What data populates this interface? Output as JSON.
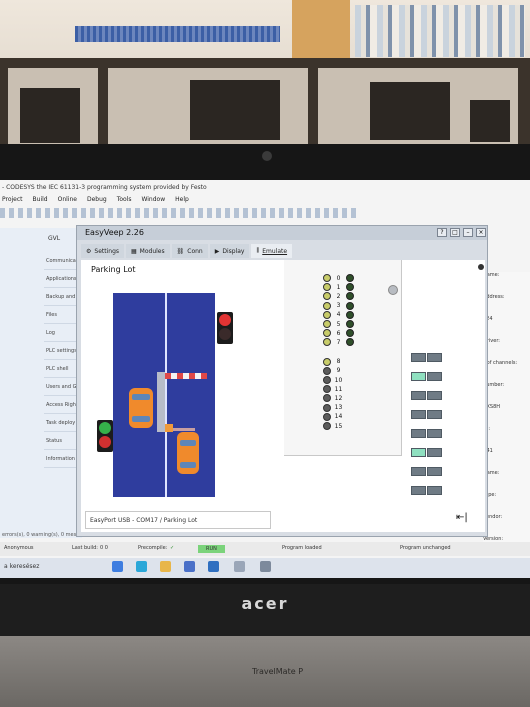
{
  "codesys": {
    "title": "- CODESYS the IEC 61131-3 programming system provided by Festo",
    "menu": [
      "Project",
      "Build",
      "Online",
      "Debug",
      "Tools",
      "Window",
      "Help"
    ],
    "gvl_tab": "GVL",
    "left_tabs": [
      "Communicat",
      "Applications",
      "Backup and",
      "Files",
      "Log",
      "PLC settings",
      "PLC shell",
      "Users and G",
      "Access Right",
      "Task deploy",
      "Status",
      "Information"
    ],
    "right_labels": [
      "Name:",
      "Address:",
      "024",
      "Driver:",
      "r of channels:",
      "number:",
      "RXS8H",
      "ID:",
      "C41",
      "Name:",
      "Type:",
      "Vendor:",
      "Version:",
      "30"
    ],
    "console_text": "errors(s), 0 warning(s), 0 message(s)",
    "status": {
      "user": "Anonymous",
      "last_build_label": "Last build:",
      "last_build_value": "0  0",
      "precompile_label": "Precompile:",
      "precompile_value": "✓",
      "run_badge": "RUN",
      "program_loaded": "Program loaded",
      "program_unchanged": "Program unchanged"
    },
    "taskbar_search": "a keresésez"
  },
  "easyveep": {
    "title": "EasyVeep 2.26",
    "window_buttons": [
      "?",
      "□",
      "–",
      "×"
    ],
    "tabs": [
      {
        "label": "Settings",
        "icon": "settings-icon"
      },
      {
        "label": "Modules",
        "icon": "modules-icon"
      },
      {
        "label": "Conn",
        "icon": "connection-icon"
      },
      {
        "label": "Display",
        "icon": "play-icon"
      },
      {
        "label": "Emulate",
        "icon": "emulate-icon"
      }
    ],
    "active_tab": "Emulate",
    "content_title": "Parking Lot",
    "io_numbers": [
      "0",
      "1",
      "2",
      "3",
      "4",
      "5",
      "6",
      "7",
      "8",
      "9",
      "10",
      "11",
      "12",
      "13",
      "14",
      "15"
    ],
    "input_states": [
      1,
      1,
      1,
      1,
      1,
      1,
      1,
      1,
      1,
      0,
      0,
      0,
      0,
      0,
      0,
      0
    ],
    "statusline": "EasyPort USB - COM17  / Parking Lot",
    "exit_icon": "exit-icon"
  },
  "laptop": {
    "brand": "acer",
    "model": "TravelMate P"
  },
  "colors": {
    "road": "#2f3d9e",
    "car": "#f08a2c",
    "led_on": "#2f4f2a",
    "led_off": "#5c5c5c",
    "display_on": "#8fe0c0"
  }
}
